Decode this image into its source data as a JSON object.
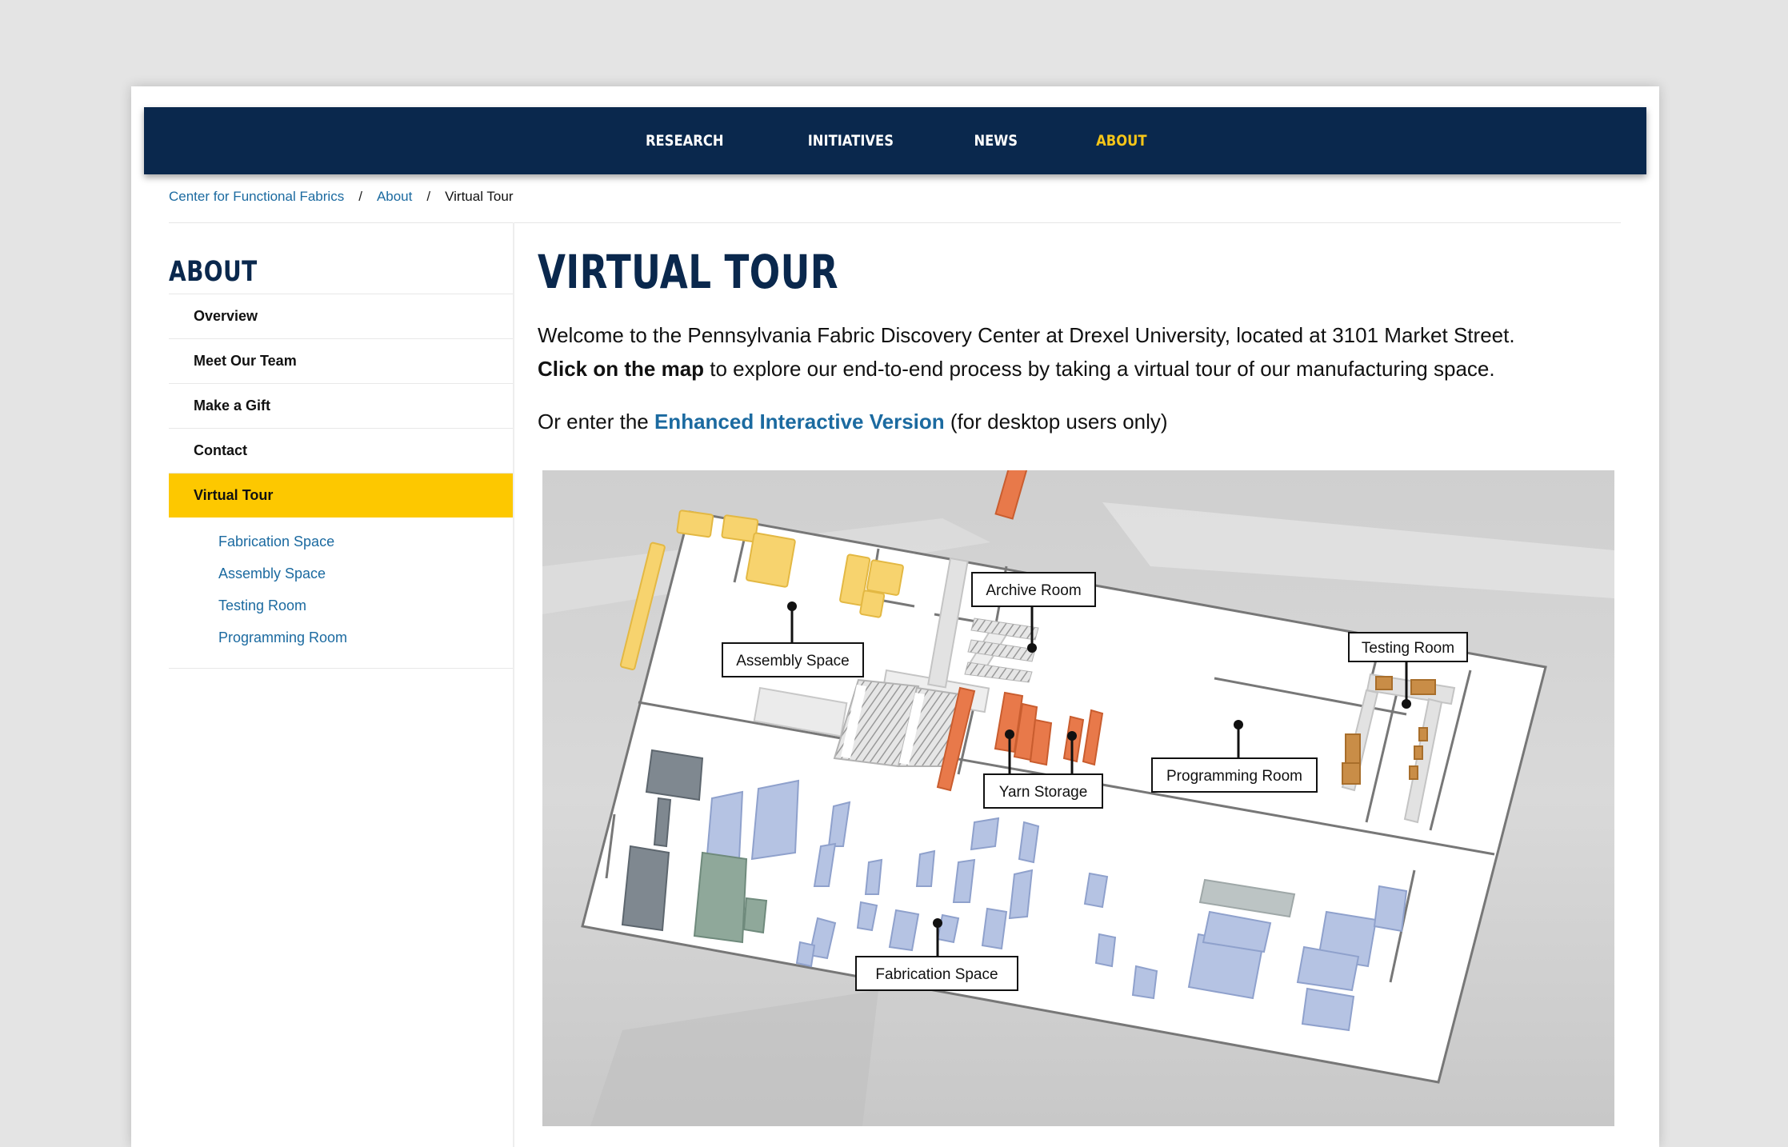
{
  "nav": {
    "items": [
      {
        "label": "RESEARCH",
        "active": false
      },
      {
        "label": "INITIATIVES",
        "active": false
      },
      {
        "label": "NEWS",
        "active": false
      },
      {
        "label": "ABOUT",
        "active": true
      }
    ]
  },
  "breadcrumb": {
    "items": [
      "Center for Functional Fabrics",
      "About",
      "Virtual Tour"
    ],
    "separator": "/"
  },
  "sidebar": {
    "title": "ABOUT",
    "items": [
      {
        "label": "Overview"
      },
      {
        "label": "Meet Our Team"
      },
      {
        "label": "Make a Gift"
      },
      {
        "label": "Contact"
      },
      {
        "label": "Virtual Tour",
        "active": true
      }
    ],
    "subitems": [
      {
        "label": "Fabrication Space"
      },
      {
        "label": "Assembly Space"
      },
      {
        "label": "Testing Room"
      },
      {
        "label": "Programming Room"
      }
    ]
  },
  "main": {
    "title": "VIRTUAL TOUR",
    "intro_text": "Welcome to the Pennsylvania Fabric Discovery Center at Drexel University, located at 3101 Market Street.",
    "intro_bold": "Click on the map",
    "intro_rest": " to explore our end-to-end process by taking a virtual tour of our manufacturing space.",
    "enhanced_prefix": "Or enter the ",
    "enhanced_link": "Enhanced Interactive Version",
    "enhanced_suffix": " (for desktop users only)"
  },
  "map": {
    "labels": {
      "archive": "Archive Room",
      "testing": "Testing Room",
      "assembly": "Assembly Space",
      "yarn": "Yarn Storage",
      "programming": "Programming Room",
      "fabrication": "Fabrication Space"
    }
  },
  "colors": {
    "navy": "#0a284d",
    "gold": "#fdc800",
    "link": "#1b6aa0",
    "zone_assembly": "#f7d36e",
    "zone_programming": "#e8794a",
    "zone_testing": "#c98d47",
    "zone_fabrication": "#b5c3e3"
  }
}
